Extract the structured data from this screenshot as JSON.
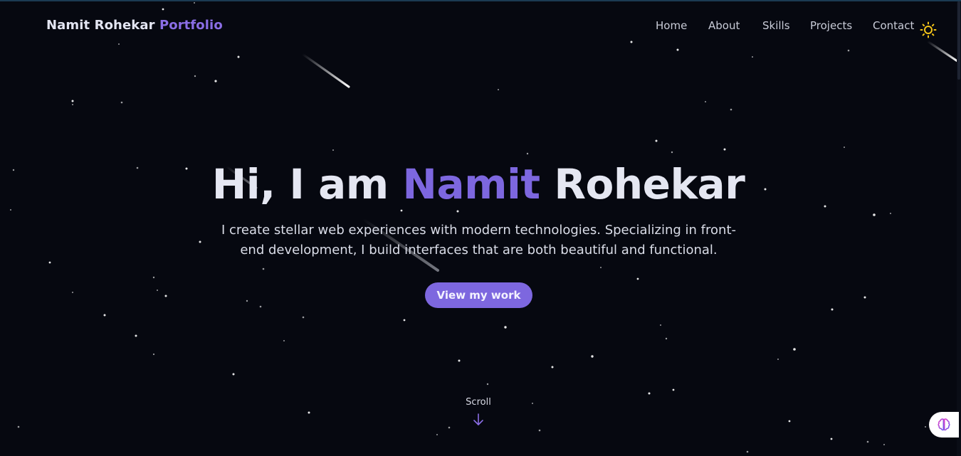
{
  "nav": {
    "brand_name": "Namit Rohekar",
    "brand_accent": "Portfolio",
    "links": [
      "Home",
      "About",
      "Skills",
      "Projects",
      "Contact"
    ],
    "theme_icon": "sun-icon"
  },
  "hero": {
    "greeting": "Hi, I am",
    "first_name": "Namit",
    "last_name": "Rohekar",
    "subtitle": "I create stellar web experiences with modern technologies. Specializing in front-end development, I build interfaces that are both beautiful and functional.",
    "cta_label": "View my work"
  },
  "scroll": {
    "label": "Scroll",
    "icon": "arrow-down-icon"
  },
  "assistant": {
    "icon": "brain-icon"
  },
  "colors": {
    "background": "#060810",
    "accent": "#7d67df",
    "text": "#e5e7f2",
    "sun": "#f5c518"
  }
}
